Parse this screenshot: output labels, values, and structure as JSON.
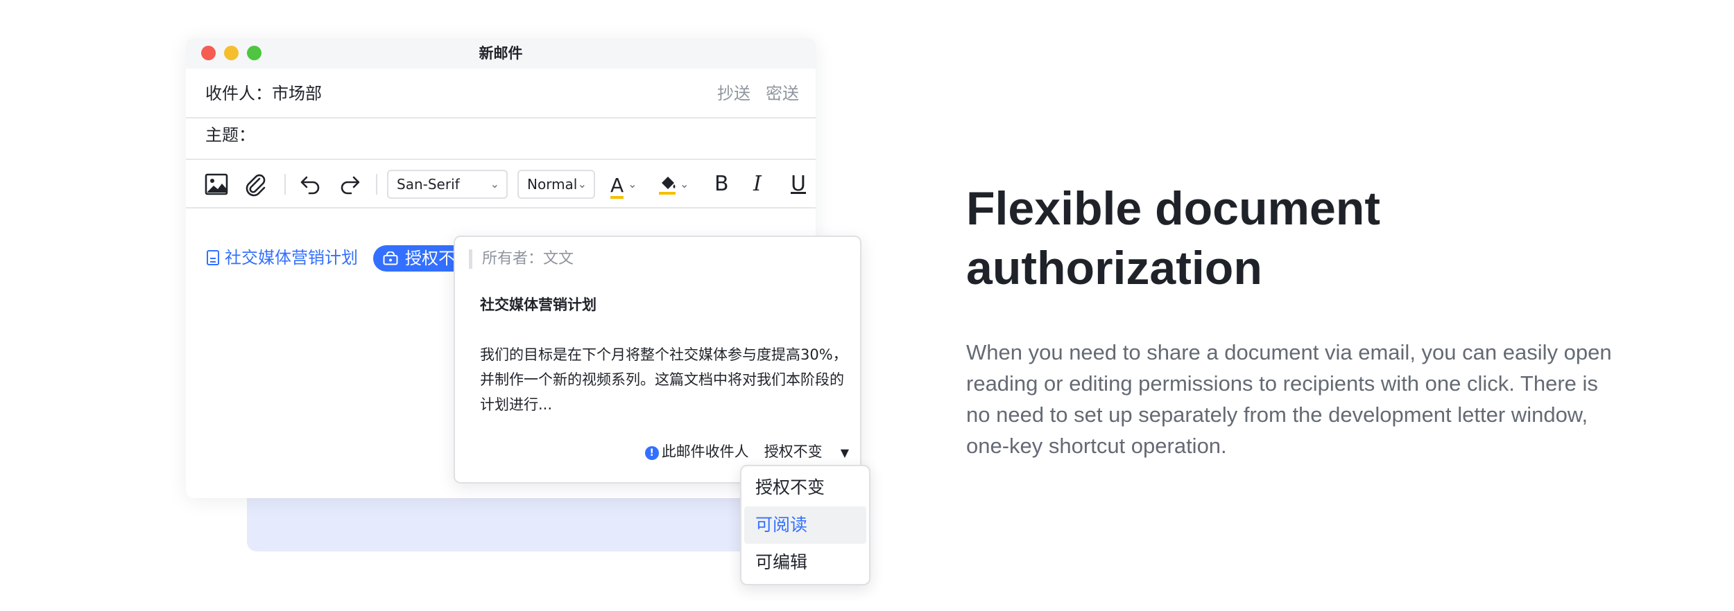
{
  "window": {
    "title": "新邮件"
  },
  "recipient": {
    "label": "收件人：",
    "value": "市场部",
    "cc_label": "抄送",
    "bcc_label": "密送"
  },
  "subject": {
    "label": "主题："
  },
  "toolbar": {
    "font_family": "San-Serif",
    "font_size": "Normal",
    "text_color_glyph": "A",
    "bold_glyph": "B",
    "italic_glyph": "I",
    "underline_glyph": "U",
    "accent_color": "#f5c000"
  },
  "attachment": {
    "doc_name": "社交媒体营销计划",
    "auth_pill_label": "授权不变"
  },
  "popover": {
    "owner": "所有者：文文",
    "doc_title": "社交媒体营销计划",
    "doc_excerpt": "我们的目标是在下个月将整个社交媒体参与度提高30%，并制作一个新的视频系列。这篇文档中将对我们本阶段的计划进行...",
    "info_glyph": "!",
    "permission_label": "此邮件收件人",
    "permission_value": "授权不变",
    "caret": "▼"
  },
  "dropdown": {
    "options": [
      "授权不变",
      "可阅读",
      "可编辑"
    ],
    "highlighted": "可阅读"
  },
  "feature": {
    "headline": "Flexible document authorization",
    "description": "When you need to share a document via email, you can easily open reading or editing permissions to recipients with one click. There is no need to set up separately from the development letter window, one-key shortcut operation."
  },
  "colors": {
    "accent_blue": "#3370ff",
    "back_card": "#e6eafd",
    "close": "#f55d53",
    "minimize": "#f4be2f",
    "maximize": "#4ec640"
  }
}
